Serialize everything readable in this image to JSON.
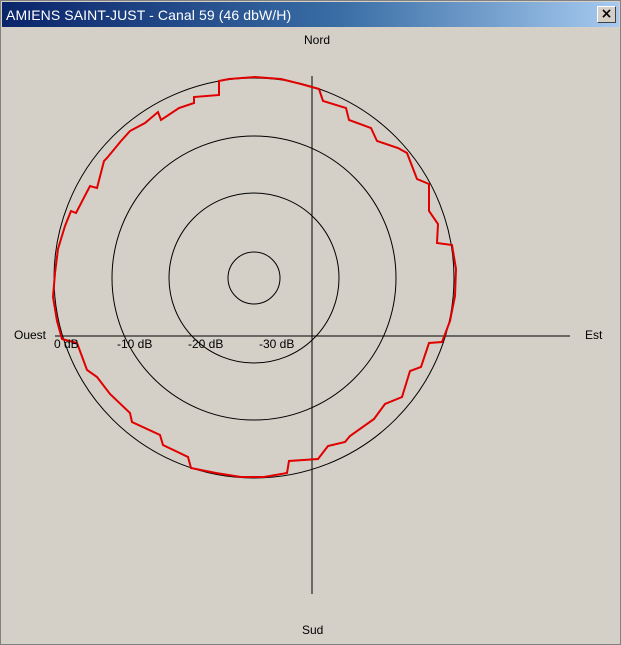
{
  "window": {
    "title": "AMIENS SAINT-JUST - Canal 59 (46 dbW/H)",
    "close_glyph": "×"
  },
  "directions": {
    "north": "Nord",
    "south": "Sud",
    "west": "Ouest",
    "east": "Est"
  },
  "ring_labels": [
    "0 dB",
    "-10 dB",
    "-20 dB",
    "-30 dB"
  ],
  "colors": {
    "pattern": "#e00000",
    "background": "#d4d0c8",
    "titlebar": "#0a246a"
  }
}
